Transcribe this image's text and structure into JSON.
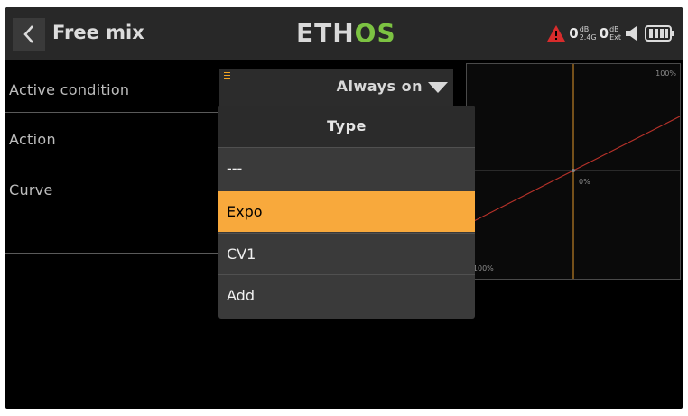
{
  "header": {
    "title": "Free mix",
    "brand_part1": "ETH",
    "brand_part2": "OS",
    "rssi1": {
      "value": "0",
      "unit": "dB",
      "label": "2.4G"
    },
    "rssi2": {
      "value": "0",
      "unit": "dB",
      "label": "Ext"
    }
  },
  "form": {
    "rows": [
      {
        "label": "Active condition"
      },
      {
        "label": "Action"
      },
      {
        "label": "Curve"
      }
    ],
    "active_condition_value": "Always on"
  },
  "graph": {
    "top_label": "100%",
    "center_label": "0%",
    "bottom_label": "-100%"
  },
  "popup": {
    "title": "Type",
    "options": [
      "---",
      "Expo",
      "CV1",
      "Add"
    ],
    "selected_index": 1
  },
  "colors": {
    "accent": "#f8a93c",
    "brand_green": "#7cc242",
    "warning": "#d82c2c",
    "curve": "#c0392b"
  }
}
